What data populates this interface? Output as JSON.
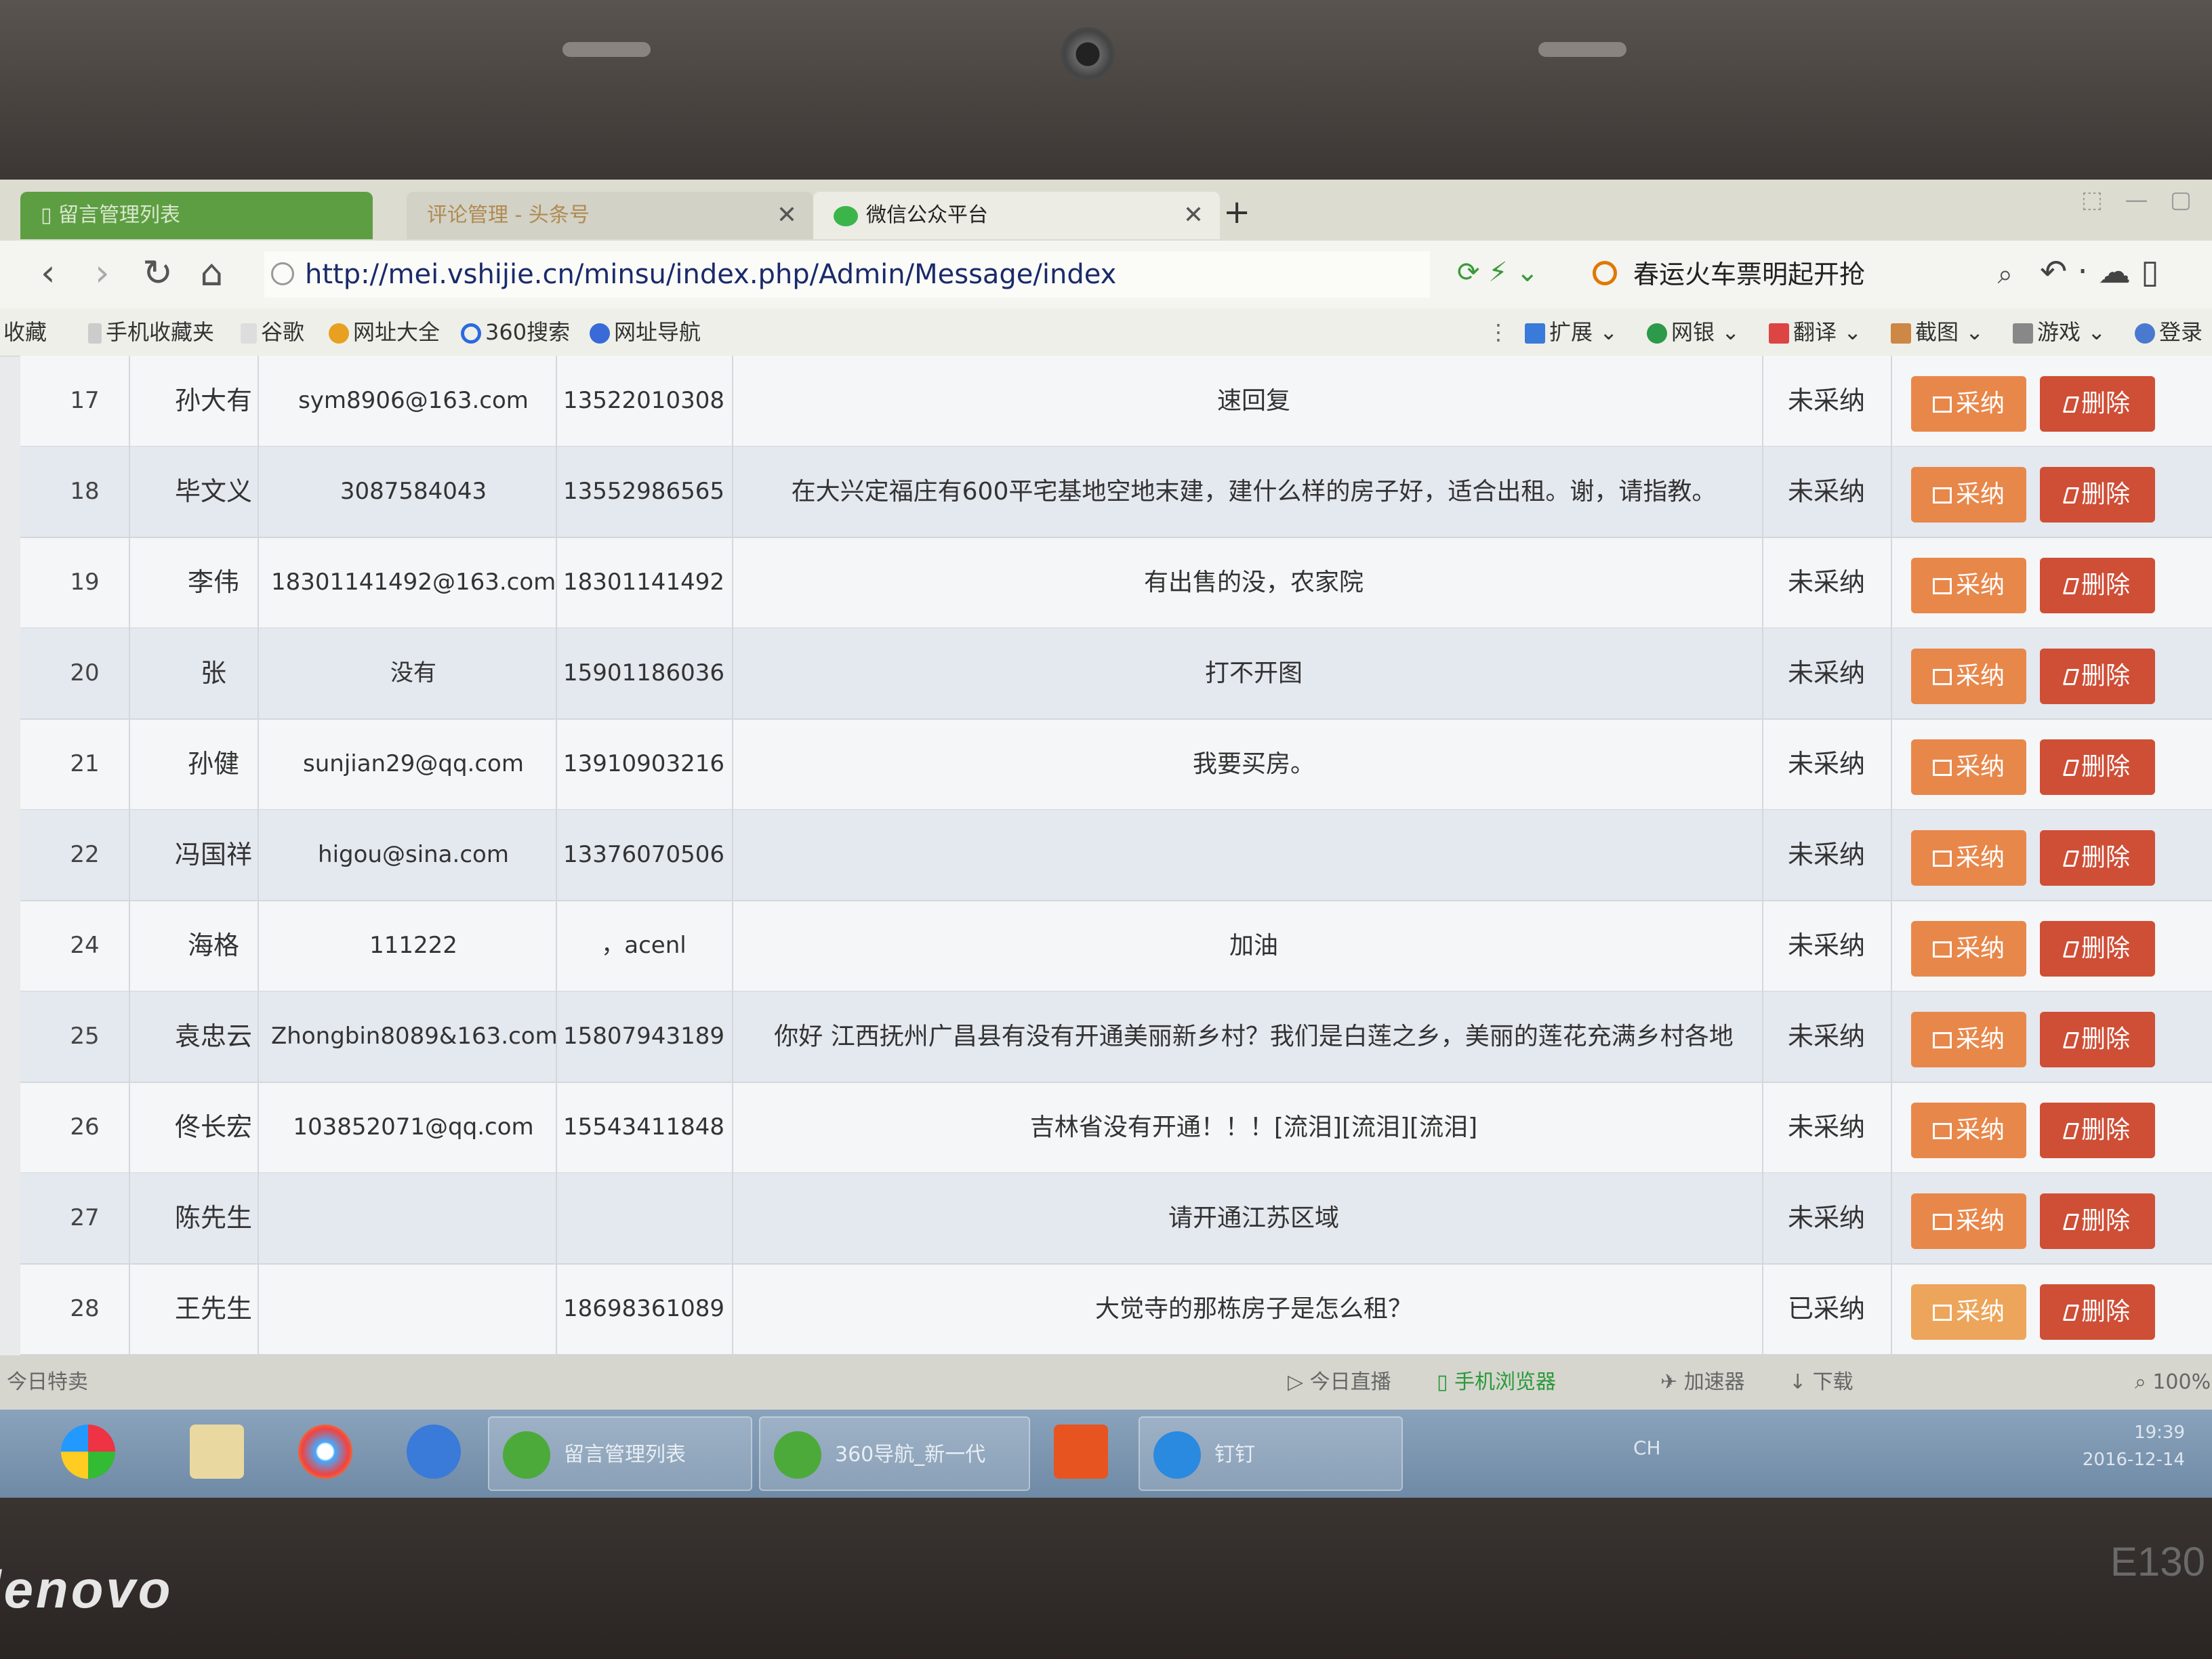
{
  "browser": {
    "tabs": [
      {
        "label": "留言管理列表"
      },
      {
        "label": "评论管理 - 头条号"
      },
      {
        "label": "微信公众平台"
      }
    ],
    "new_tab": "+",
    "url": "http://mei.vshijie.cn/minsu/index.php/Admin/Message/index",
    "search_text": "春运火车票明起开抢"
  },
  "bookmarks": {
    "left": [
      "收藏",
      "手机收藏夹",
      "谷歌",
      "网址大全",
      "360搜索",
      "网址导航"
    ],
    "right": [
      "扩展",
      "网银",
      "翻译",
      "截图",
      "游戏",
      "登录"
    ]
  },
  "table": {
    "adopt_label": "采纳",
    "delete_label": "删除",
    "rows": [
      {
        "id": "17",
        "name": "孙大有",
        "email": "sym8906@163.com",
        "phone": "13522010308",
        "message": "速回复",
        "status": "未采纳"
      },
      {
        "id": "18",
        "name": "毕文义",
        "email": "3087584043",
        "phone": "13552986565",
        "message": "在大兴定福庄有600平宅基地空地末建，建什么样的房子好，适合出租。谢，请指教。",
        "status": "未采纳"
      },
      {
        "id": "19",
        "name": "李伟",
        "email": "18301141492@163.com",
        "phone": "18301141492",
        "message": "有出售的没，农家院",
        "status": "未采纳"
      },
      {
        "id": "20",
        "name": "张",
        "email": "没有",
        "phone": "15901186036",
        "message": "打不开图",
        "status": "未采纳"
      },
      {
        "id": "21",
        "name": "孙健",
        "email": "sunjian29@qq.com",
        "phone": "13910903216",
        "message": "我要买房。",
        "status": "未采纳"
      },
      {
        "id": "22",
        "name": "冯国祥",
        "email": "higou@sina.com",
        "phone": "13376070506",
        "message": "",
        "status": "未采纳"
      },
      {
        "id": "24",
        "name": "海格",
        "email": "111222",
        "phone": "，acenl",
        "message": "加油",
        "status": "未采纳"
      },
      {
        "id": "25",
        "name": "袁忠云",
        "email": "Zhongbin8089&163.com",
        "phone": "15807943189",
        "message": "你好 江西抚州广昌县有没有开通美丽新乡村？我们是白莲之乡，美丽的莲花充满乡村各地",
        "status": "未采纳"
      },
      {
        "id": "26",
        "name": "佟长宏",
        "email": "103852071@qq.com",
        "phone": "15543411848",
        "message": "吉林省没有开通！！！[流泪][流泪][流泪]",
        "status": "未采纳"
      },
      {
        "id": "27",
        "name": "陈先生",
        "email": "",
        "phone": "",
        "message": "请开通江苏区域",
        "status": "未采纳"
      },
      {
        "id": "28",
        "name": "王先生",
        "email": "",
        "phone": "18698361089",
        "message": "大觉寺的那栋房子是怎么租？",
        "status": "已采纳"
      }
    ]
  },
  "statusbar": {
    "left": "今日特卖",
    "items": [
      "今日直播",
      "手机浏览器",
      "加速器",
      "下载",
      "100%"
    ]
  },
  "taskbar": {
    "items": [
      "留言管理列表",
      "360导航_新一代",
      "钉钉"
    ],
    "tray_time": "19:39",
    "tray_date": "2016-12-14",
    "tray_lang": "CH"
  },
  "laptop": {
    "brand": "lenovo",
    "model": "E130"
  }
}
